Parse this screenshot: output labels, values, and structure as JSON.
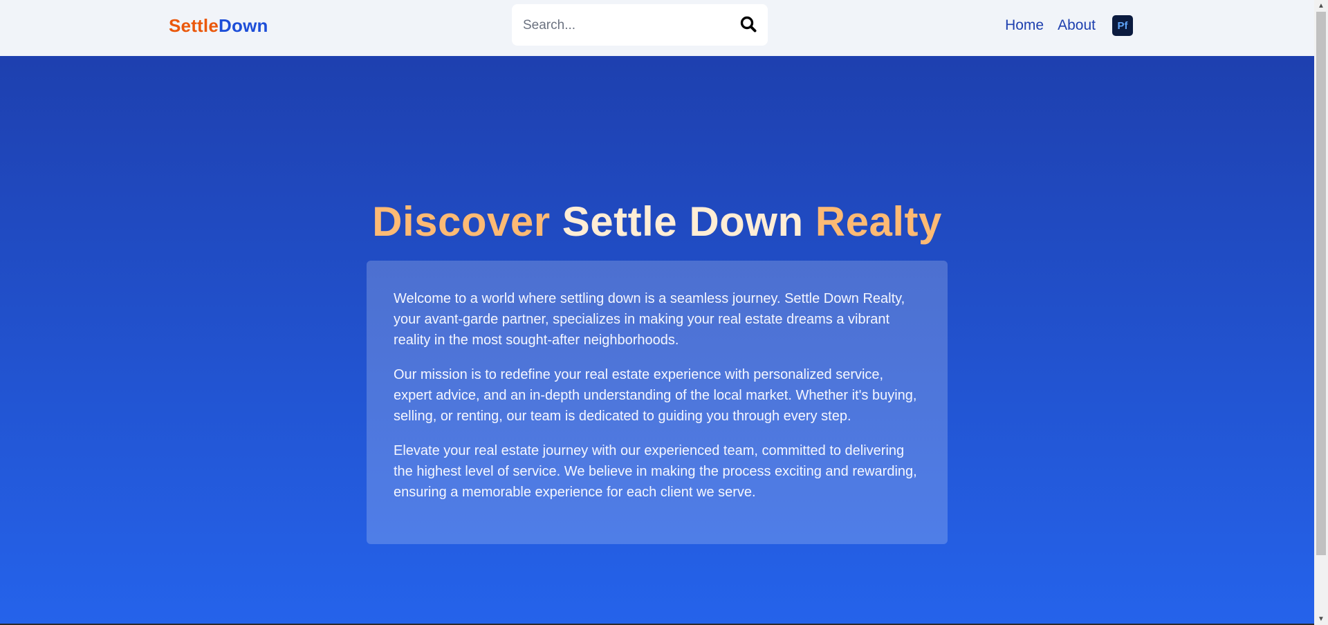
{
  "header": {
    "brand_part1": "Settle",
    "brand_part2": "Down",
    "search_placeholder": "Search...",
    "search_icon": "search-icon",
    "nav": {
      "home": "Home",
      "about": "About",
      "badge": "Pf"
    }
  },
  "hero": {
    "title_word1": "Discover",
    "title_word2": "Settle Down",
    "title_word3": "Realty",
    "paragraphs": [
      "Welcome to a world where settling down is a seamless journey. Settle Down Realty, your avant-garde partner, specializes in making your real estate dreams a vibrant reality in the most sought-after neighborhoods.",
      "Our mission is to redefine your real estate experience with personalized service, expert advice, and an in-depth understanding of the local market. Whether it's buying, selling, or renting, our team is dedicated to guiding you through every step.",
      "Elevate your real estate journey with our experienced team, committed to delivering the highest level of service. We believe in making the process exciting and rewarding, ensuring a memorable experience for each client we serve."
    ]
  },
  "colors": {
    "brand_orange": "#ea580c",
    "brand_blue": "#1d4ed8",
    "title_orange": "#fdba74",
    "title_cream": "#ffedd5",
    "hero_top": "#1e40af",
    "hero_bottom": "#2563eb"
  }
}
